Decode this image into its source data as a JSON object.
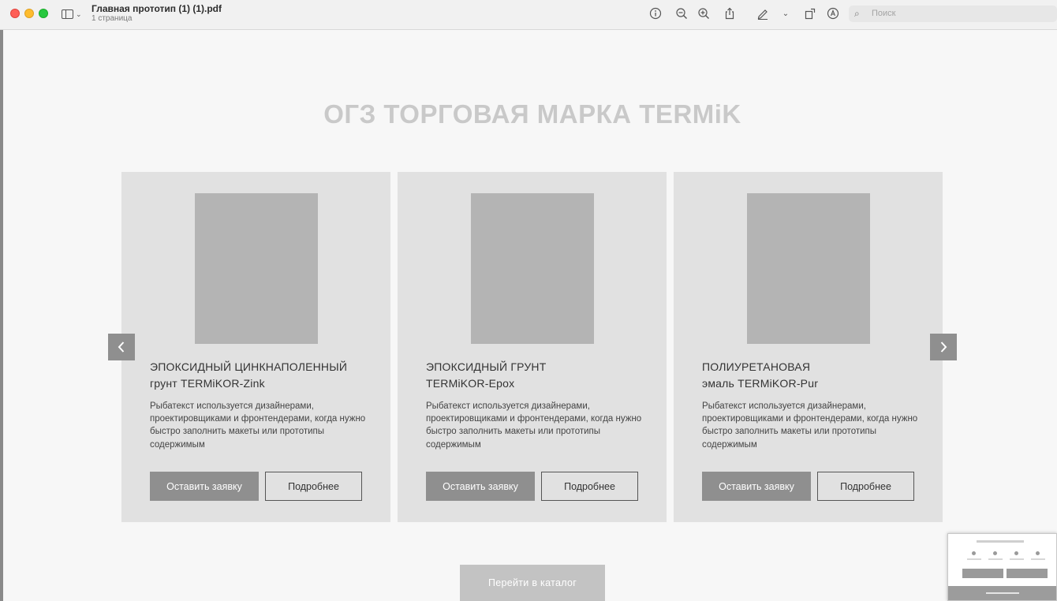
{
  "window": {
    "title": "Главная прототип (1) (1).pdf",
    "subtitle": "1 страница",
    "search_placeholder": "Поиск",
    "icons": [
      "sidebar-icon",
      "info-icon",
      "zoom-out-icon",
      "zoom-in-icon",
      "share-icon",
      "highlight-pen-icon",
      "rotate-icon",
      "markup-icon",
      "search-icon"
    ]
  },
  "page": {
    "heading": "ОГЗ ТОРГОВАЯ МАРКА TERMiK",
    "cards": [
      {
        "title_line1": "Эпоксидный цинкнаполенный",
        "title_line2": "грунт TERMiKOR-Zink",
        "description": "Рыбатекст используется дизайнерами, проектировщиками и фронтендерами, когда нужно быстро заполнить макеты или прототипы содержимым",
        "primary_button": "Оставить заявку",
        "secondary_button": "Подробнее"
      },
      {
        "title_line1": "Эпоксидный грунт",
        "title_line2": "TERMiKOR-Epox",
        "description": "Рыбатекст используется дизайнерами, проектировщиками и фронтендерами, когда нужно быстро заполнить макеты или прототипы содержимым",
        "primary_button": "Оставить заявку",
        "secondary_button": "Подробнее"
      },
      {
        "title_line1": "Полиуретановая",
        "title_line2": "эмаль TERMiKOR-Pur",
        "description": "Рыбатекст используется дизайнерами, проектировщиками и фронтендерами, когда нужно быстро заполнить макеты или прототипы содержимым",
        "primary_button": "Оставить заявку",
        "secondary_button": "Подробнее"
      }
    ],
    "catalog_button": "Перейти в каталог"
  },
  "colors": {
    "card_bg": "#e1e1e1",
    "image_placeholder": "#b4b4b4",
    "button_primary": "#8f8f8f",
    "heading": "#c9c9c9"
  }
}
